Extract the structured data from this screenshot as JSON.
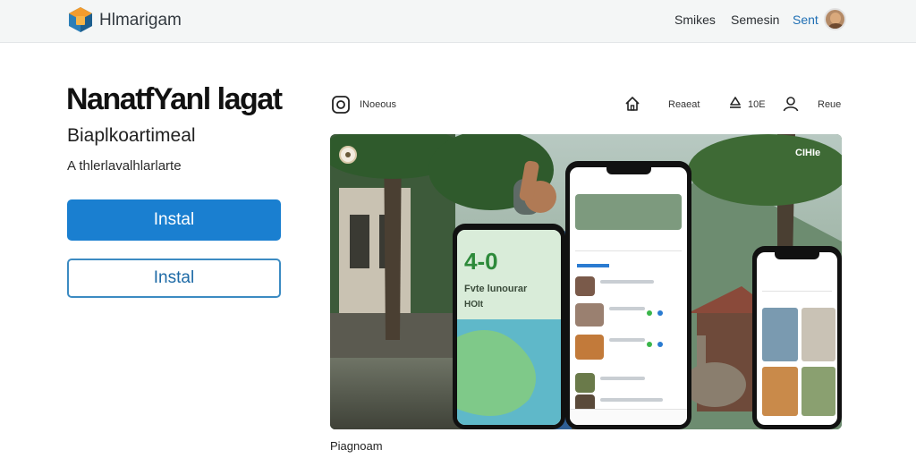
{
  "header": {
    "app_name": "Hlmarigam",
    "nav": [
      "Smikes",
      "Semesin",
      "Sent"
    ],
    "colors": {
      "accent": "#1f6fb4",
      "background": "#f4f6f6"
    }
  },
  "app": {
    "title": "NanatfYanl lagat",
    "subtitle": "Biaplkoartimeal",
    "meta": "A thlerlavalhlarlarte",
    "primary_button": "Instal",
    "secondary_button": "Instal",
    "colors": {
      "primary": "#1a7fd0",
      "secondary_border": "#3c8bc2"
    }
  },
  "toolbar": {
    "left_label": "INoeous",
    "items": [
      {
        "icon": "home-icon",
        "label": ""
      },
      {
        "icon": "",
        "label": "Reaeat"
      },
      {
        "icon": "recycle-icon",
        "label": "10E"
      },
      {
        "icon": "user-icon",
        "label": "Reue"
      }
    ]
  },
  "hero": {
    "tag": "CIHIe",
    "phone_left_text": [
      "4-0",
      "Fvte lunourar",
      "HOIt"
    ]
  },
  "caption": "Piagnoam"
}
